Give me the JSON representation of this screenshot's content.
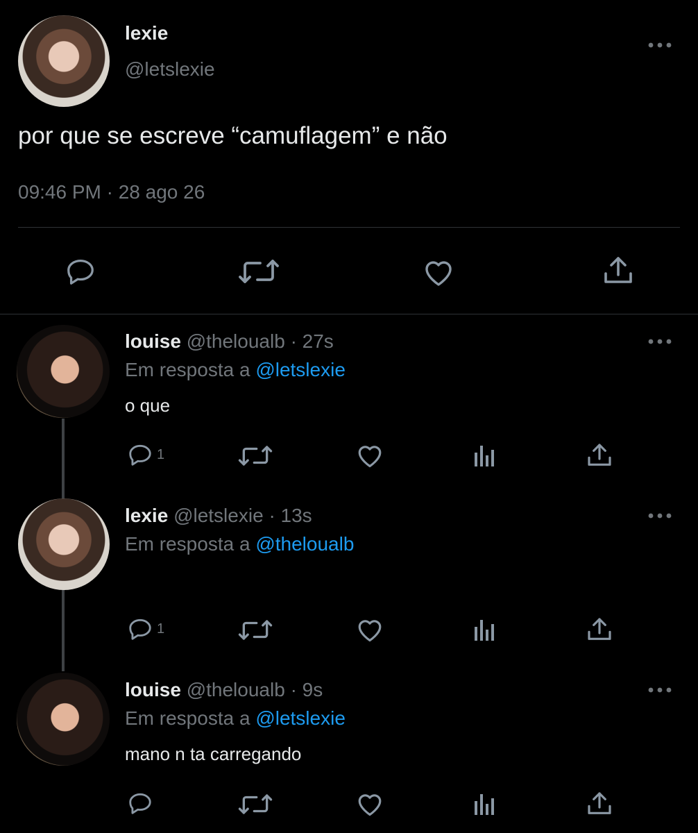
{
  "main_tweet": {
    "display_name": "lexie",
    "handle": "@letslexie",
    "text": "por que se escreve “camuflagem” e não",
    "timestamp": "09:46 PM · 28 ago 26"
  },
  "replies": [
    {
      "display_name": "louise",
      "handle": "@theloualb",
      "time": "· 27s",
      "reply_prefix": "Em resposta a",
      "reply_to": "@letslexie",
      "text": "o que",
      "reply_count": "1"
    },
    {
      "display_name": "lexie",
      "handle": "@letslexie",
      "time": "· 13s",
      "reply_prefix": "Em resposta a",
      "reply_to": "@theloualb",
      "text": "",
      "reply_count": "1"
    },
    {
      "display_name": "louise",
      "handle": "@theloualb",
      "time": "· 9s",
      "reply_prefix": "Em resposta a",
      "reply_to": "@letslexie",
      "text": "mano n ta carregando",
      "reply_count": ""
    }
  ],
  "icons": [
    "more-icon",
    "reply-icon",
    "retweet-icon",
    "like-icon",
    "share-icon",
    "views-icon"
  ],
  "colors": {
    "background": "#000000",
    "text": "#e7e9ea",
    "secondary": "#71767b",
    "link": "#1d9bf0",
    "divider": "#2f3336"
  }
}
